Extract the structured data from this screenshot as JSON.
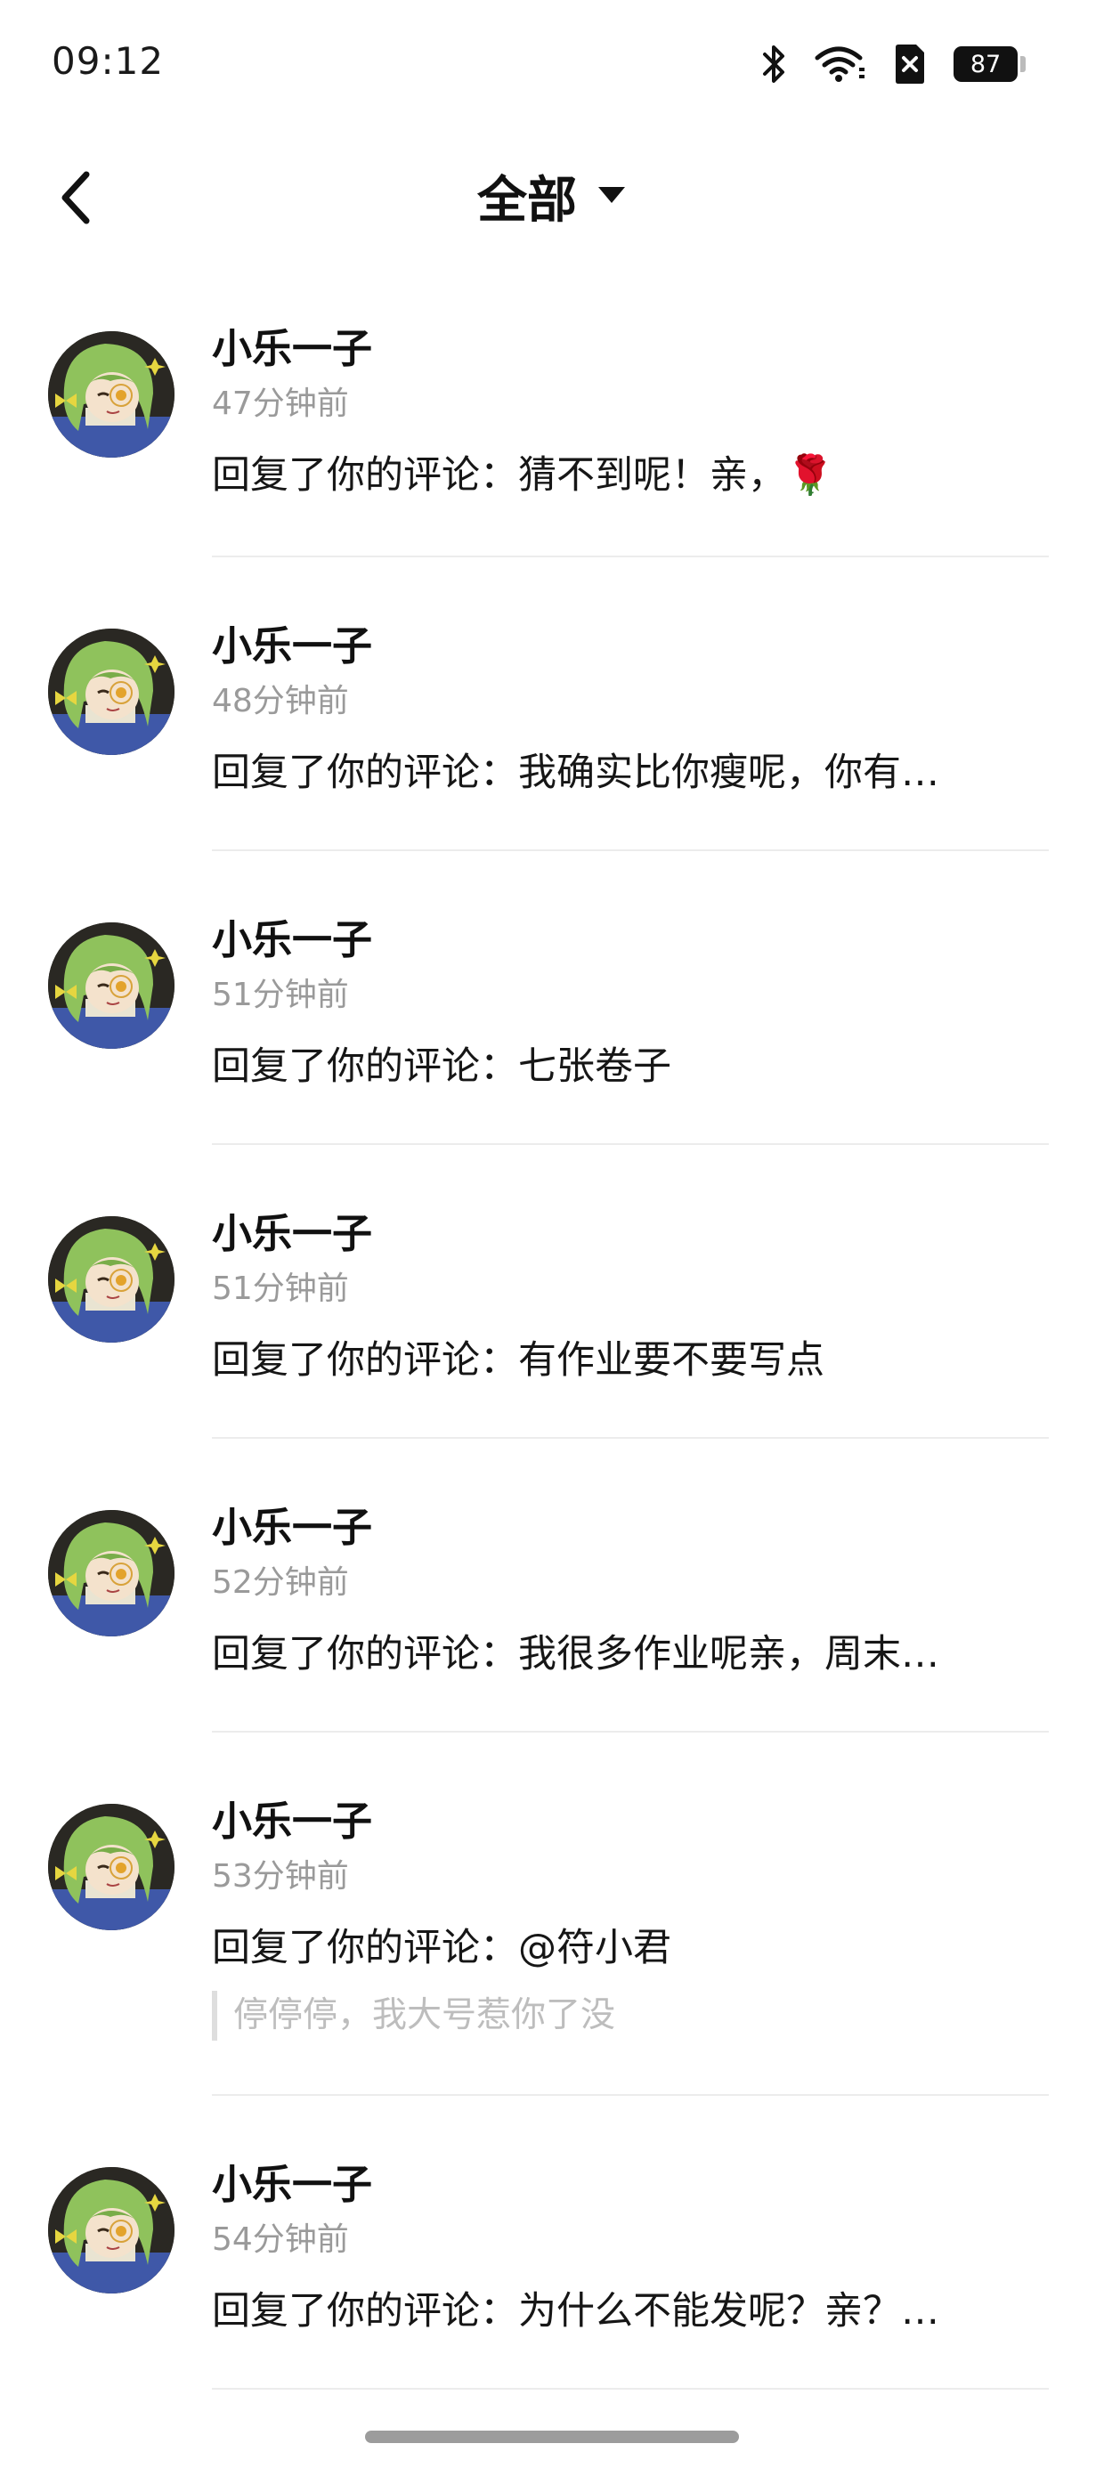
{
  "status_bar": {
    "time": "09:12",
    "battery": "87",
    "icons": [
      "bluetooth-icon",
      "wifi-icon",
      "sim-off-icon",
      "battery-icon"
    ]
  },
  "nav": {
    "back_icon": "chevron-left-icon",
    "filter_label": "全部",
    "filter_icon": "caret-down-icon"
  },
  "notifications": [
    {
      "user": "小乐一子",
      "time": "47分钟前",
      "text": "回复了你的评论：猜不到呢！亲，🌹"
    },
    {
      "user": "小乐一子",
      "time": "48分钟前",
      "text": "回复了你的评论：我确实比你瘦呢，你有…"
    },
    {
      "user": "小乐一子",
      "time": "51分钟前",
      "text": "回复了你的评论：七张卷子"
    },
    {
      "user": "小乐一子",
      "time": "51分钟前",
      "text": "回复了你的评论：有作业要不要写点"
    },
    {
      "user": "小乐一子",
      "time": "52分钟前",
      "text": "回复了你的评论：我很多作业呢亲，周末…"
    },
    {
      "user": "小乐一子",
      "time": "53分钟前",
      "text": "回复了你的评论：@符小君",
      "quote": "停停停，我大号惹你了没"
    },
    {
      "user": "小乐一子",
      "time": "54分钟前",
      "text": "回复了你的评论：为什么不能发呢？亲？…"
    }
  ],
  "colors": {
    "text": "#141414",
    "secondary": "#9a9a9a",
    "quote": "#bdbdbd",
    "divider": "#ececec",
    "avatar_hair": "#8fc25c"
  }
}
